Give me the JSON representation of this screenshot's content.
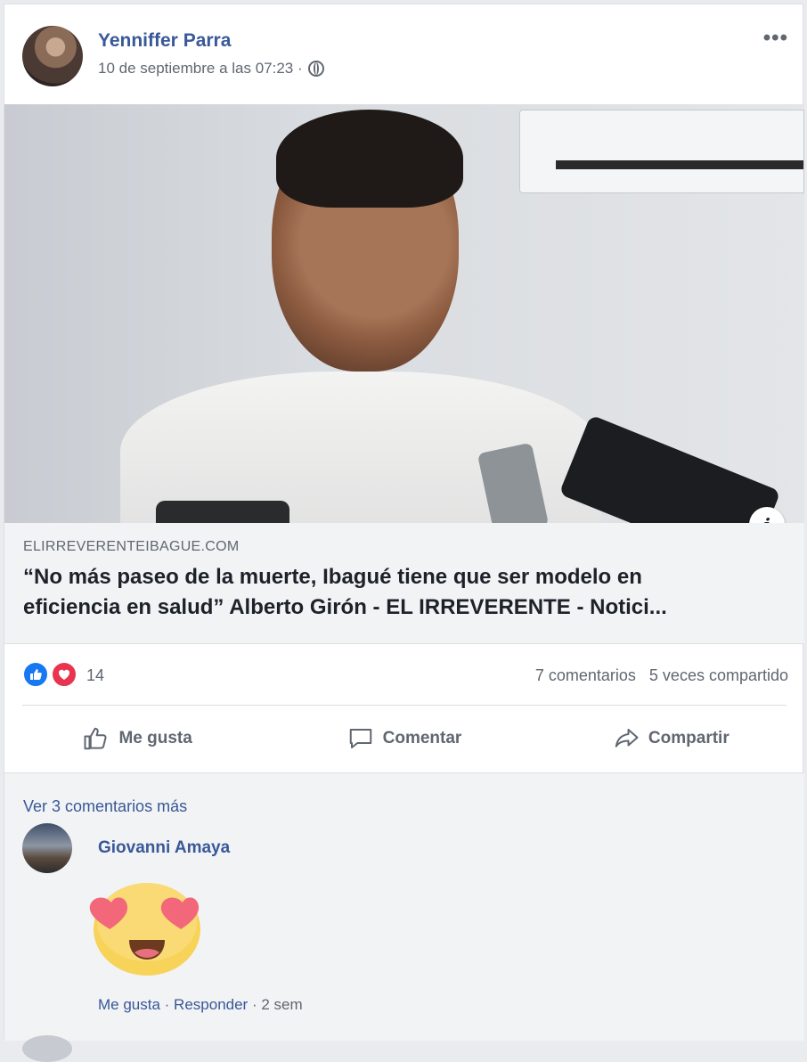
{
  "post": {
    "author": "Yenniffer Parra",
    "timestamp": "10 de septiembre a las 07:23 ·",
    "privacy_icon": "globe-icon",
    "options": "•••"
  },
  "link": {
    "domain": "ELIRREVERENTEIBAGUE.COM",
    "title_line1": "“No más paseo de la muerte, Ibagué tiene que ser modelo en",
    "title_line2": "eficiencia en salud” Alberto Girón - EL IRREVERENTE - Notici...",
    "info": "i"
  },
  "stats": {
    "reaction_icons": [
      "like-reaction-icon",
      "love-reaction-icon"
    ],
    "reaction_count": "14",
    "comments": "7 comentarios",
    "shares": "5 veces compartido"
  },
  "actions": {
    "like": "Me gusta",
    "comment": "Comentar",
    "share": "Compartir"
  },
  "comments": {
    "view_more": "Ver 3 comentarios más",
    "items": [
      {
        "name": "Giovanni Amaya",
        "sticker": "heart-eyes-emoji",
        "like": "Me gusta",
        "sep1": " · ",
        "reply": "Responder",
        "sep2": " · ",
        "age": "2 sem"
      }
    ]
  },
  "colors": {
    "link_blue": "#385898",
    "secondary_text": "#606770",
    "like_blue": "#1877f2",
    "love_red": "#e8344e",
    "page_bg": "#e9ebee"
  }
}
